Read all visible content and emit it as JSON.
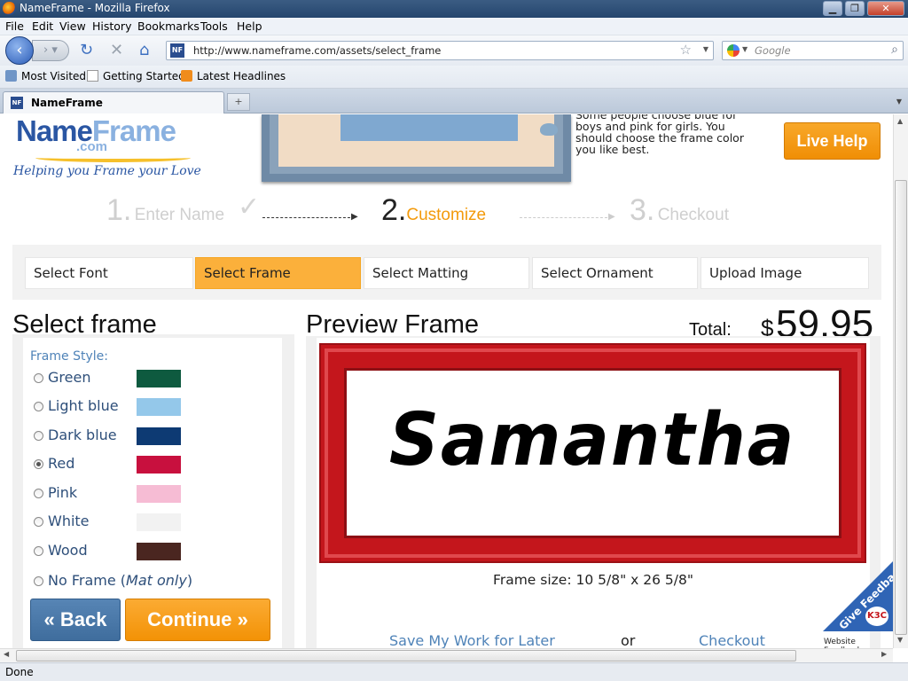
{
  "window": {
    "title": "NameFrame - Mozilla Firefox",
    "controls": {
      "minimize": "▁",
      "maximize": "❐",
      "close": "✕"
    }
  },
  "menu": [
    "File",
    "Edit",
    "View",
    "History",
    "Bookmarks",
    "Tools",
    "Help"
  ],
  "nav": {
    "url": "http://www.nameframe.com/assets/select_frame",
    "search_placeholder": "Google",
    "site_icon": "NF"
  },
  "bookmarks": [
    "Most Visited",
    "Getting Started",
    "Latest Headlines"
  ],
  "tab": {
    "label": "NameFrame",
    "icon": "NF"
  },
  "header": {
    "logo_name": "Name",
    "logo_frame": "Frame",
    "logo_dotcom": ".com",
    "tagline": "Helping you Frame your Love",
    "tip": "Some people choose blue for boys and pink for girls. You should choose the frame color you like best.",
    "live_help": "Live Help"
  },
  "steps": [
    {
      "num": "1.",
      "label": "Enter Name"
    },
    {
      "num": "2.",
      "label": "Customize"
    },
    {
      "num": "3.",
      "label": "Checkout"
    }
  ],
  "option_tabs": [
    "Select Font",
    "Select Frame",
    "Select Matting",
    "Select Ornament",
    "Upload Image"
  ],
  "active_tab": "Select Frame",
  "left": {
    "heading": "Select frame",
    "style_label": "Frame Style:",
    "options": [
      {
        "label": "Green",
        "color": "#0e5a3f",
        "selected": false
      },
      {
        "label": "Light blue",
        "color": "#94c8ea",
        "selected": false
      },
      {
        "label": "Dark blue",
        "color": "#0d3a73",
        "selected": false
      },
      {
        "label": "Red",
        "color": "#c8103e",
        "selected": true
      },
      {
        "label": "Pink",
        "color": "#f6bcd4",
        "selected": false
      },
      {
        "label": "White",
        "color": "#f2f2f2",
        "selected": false
      },
      {
        "label": "Wood",
        "color": "#4a2620",
        "selected": false
      }
    ],
    "no_frame_label": "No Frame (",
    "no_frame_note": "Mat only",
    "no_frame_close": ")",
    "back_label": "« Back",
    "continue_label": "Continue »"
  },
  "preview": {
    "heading": "Preview Frame",
    "total_label": "Total:",
    "currency": "$",
    "total": "59.95",
    "name_text": "Samantha",
    "frame_size": "Frame size: 10 5/8\" x 26 5/8\"",
    "save_link": "Save My Work for Later",
    "or": "or",
    "checkout_link": "Checkout"
  },
  "feedback": {
    "badge": "Give Feedback",
    "logo": "K3C",
    "label": "Website Feedback"
  },
  "status": "Done"
}
